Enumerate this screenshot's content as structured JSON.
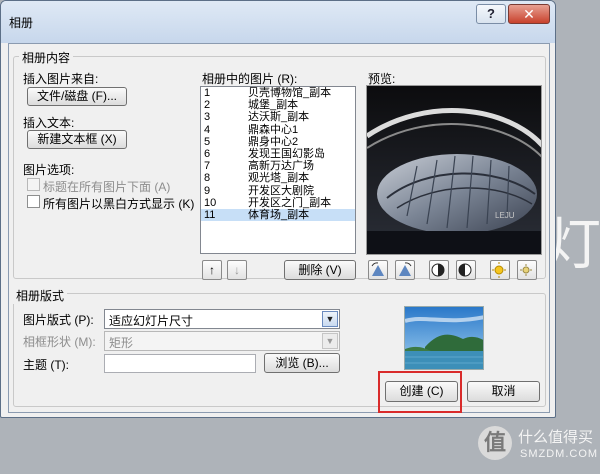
{
  "background": {
    "text": "灯"
  },
  "watermark": {
    "badge": "值",
    "line1": "什么值得买",
    "line2": "SMZDM.COM"
  },
  "dialog": {
    "title": "相册",
    "help_label": "?",
    "close_label": "✕"
  },
  "album_content": {
    "group_label": "相册内容",
    "insert_picture_label": "插入图片来自:",
    "file_disk_button": "文件/磁盘 (F)...",
    "insert_text_label": "插入文本:",
    "new_textbox_button": "新建文本框 (X)",
    "picture_options_label": "图片选项:",
    "captions_below": "标题在所有图片下面 (A)",
    "black_white": "所有图片以黑白方式显示 (K)"
  },
  "pictures": {
    "label": "相册中的图片 (R):",
    "items": [
      {
        "num": "1",
        "name": "贝壳博物馆_副本"
      },
      {
        "num": "2",
        "name": "城堡_副本"
      },
      {
        "num": "3",
        "name": "达沃斯_副本"
      },
      {
        "num": "4",
        "name": "鼎森中心1"
      },
      {
        "num": "5",
        "name": "鼎身中心2"
      },
      {
        "num": "6",
        "name": "发现王国幻影岛"
      },
      {
        "num": "7",
        "name": "高新万达广场"
      },
      {
        "num": "8",
        "name": "观光塔_副本"
      },
      {
        "num": "9",
        "name": "开发区大剧院"
      },
      {
        "num": "10",
        "name": "开发区之门_副本"
      },
      {
        "num": "11",
        "name": "体育场_副本"
      }
    ],
    "selected_index": 10,
    "move_up": "↑",
    "move_down": "↓",
    "delete_button": "删除 (V)"
  },
  "preview": {
    "label": "预览:"
  },
  "album_layout": {
    "group_label": "相册版式",
    "picture_layout_label": "图片版式 (P):",
    "picture_layout_value": "适应幻灯片尺寸",
    "frame_shape_label": "相框形状 (M):",
    "frame_shape_value": "矩形",
    "theme_label": "主题 (T):",
    "theme_value": "",
    "browse_button": "浏览 (B)..."
  },
  "actions": {
    "create_button": "创建 (C)",
    "cancel_button": "取消"
  },
  "colors": {
    "highlight": "#d92b2b",
    "selection": "#c7dff7",
    "titlebar": "#c7d7ec"
  }
}
